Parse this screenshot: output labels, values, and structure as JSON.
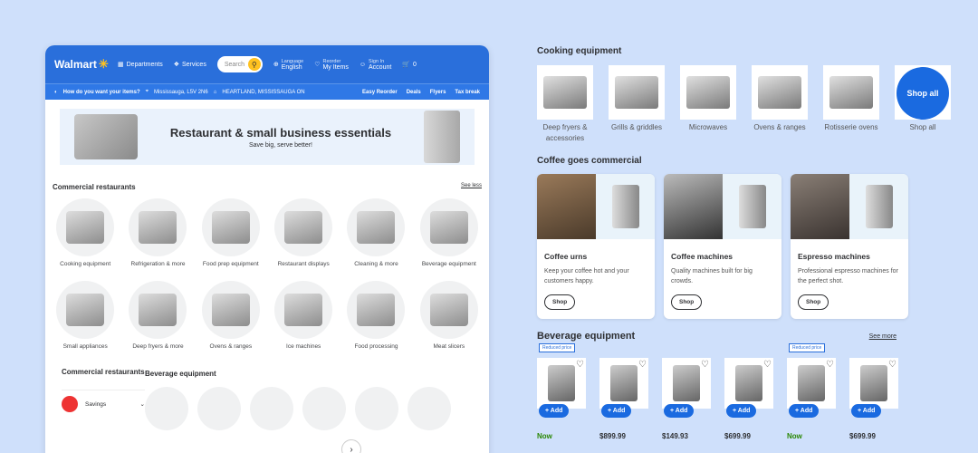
{
  "header": {
    "brand": "Walmart",
    "departments": "Departments",
    "services": "Services",
    "search_placeholder": "Search",
    "language_small": "Language",
    "language": "English",
    "reorder_small": "Reorder",
    "my_items": "My Items",
    "signin_small": "Sign In",
    "account": "Account",
    "cart_count": "0"
  },
  "subheader": {
    "prompt": "How do you want your items?",
    "location": "Mississauga, L5V 2N6",
    "store": "HEARTLAND, MISSISSAUGA ON",
    "links": [
      "Easy Reorder",
      "Deals",
      "Flyers",
      "Tax break"
    ]
  },
  "banner": {
    "title": "Restaurant & small business essentials",
    "subtitle": "Save big, serve better!"
  },
  "commercial": {
    "title": "Commercial restaurants",
    "see_less": "See less",
    "items": [
      "Cooking equipment",
      "Refrigeration & more",
      "Food prep equipment",
      "Restaurant displays",
      "Cleaning & more",
      "Beverage equipment",
      "Small appliances",
      "Deep fryers & more",
      "Ovens & ranges",
      "Ice machines",
      "Food processing",
      "Meat slicers"
    ]
  },
  "lower": {
    "side_title": "Commercial restaurants",
    "side_item": "Savings",
    "main_title": "Beverage equipment"
  },
  "cooking": {
    "title": "Cooking equipment",
    "items": [
      "Deep fryers & accessories",
      "Grills & griddles",
      "Microwaves",
      "Ovens & ranges",
      "Rotisserie ovens"
    ],
    "shop_all": "Shop all",
    "shop_all_label": "Shop all"
  },
  "coffee": {
    "title": "Coffee goes commercial",
    "cards": [
      {
        "title": "Coffee urns",
        "desc": "Keep your coffee hot and your customers happy.",
        "button": "Shop"
      },
      {
        "title": "Coffee machines",
        "desc": "Quality machines built for big crowds.",
        "button": "Shop"
      },
      {
        "title": "Espresso machines",
        "desc": "Professional espresso machines for the perfect shot.",
        "button": "Shop"
      }
    ]
  },
  "beverage": {
    "title": "Beverage equipment",
    "see_more": "See more",
    "flag": "Reduced price",
    "add_label": "+ Add",
    "prices": [
      "Now",
      "$899.99",
      "$149.93",
      "$699.99",
      "Now",
      "$699.99"
    ]
  },
  "colors": {
    "brand_blue": "#2a6fdb",
    "spark": "#ffc220",
    "now_green": "#2a8703"
  }
}
